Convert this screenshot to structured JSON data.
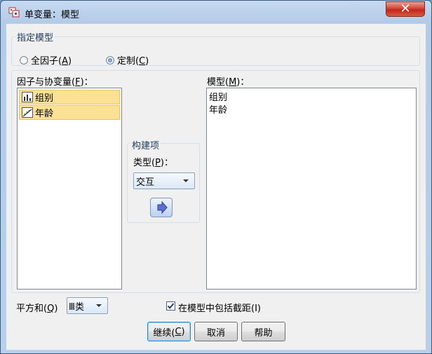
{
  "window": {
    "title": "单变量：模型",
    "close_glyph": "✕"
  },
  "specify_model": {
    "group_label": "指定模型",
    "options": [
      {
        "label": "全因子(",
        "mnemonic": "A",
        "suffix": ")",
        "selected": false
      },
      {
        "label": "定制(",
        "mnemonic": "C",
        "suffix": ")",
        "selected": true
      }
    ]
  },
  "factors": {
    "label_pre": "因子与协变量(",
    "mnemonic": "F",
    "label_post": ")：",
    "items": [
      {
        "label": "组别",
        "icon": "nominal-bar-icon"
      },
      {
        "label": "年龄",
        "icon": "scale-ruler-icon"
      }
    ]
  },
  "build_term": {
    "group_label": "构建项",
    "type_label_pre": "类型(",
    "type_mnemonic": "P",
    "type_label_post": ")：",
    "type_value": "交互",
    "move_icon": "arrow-right-icon"
  },
  "model": {
    "label_pre": "模型(",
    "mnemonic": "M",
    "label_post": ")：",
    "items": [
      "组别",
      "年龄"
    ]
  },
  "sum_of_squares": {
    "label_pre": "平方和(",
    "mnemonic": "Q",
    "label_post": ")",
    "value": "Ⅲ类"
  },
  "include_intercept": {
    "label": "在模型中包括截距(I)",
    "checked": true
  },
  "buttons": {
    "continue_pre": "继续(",
    "continue_mnemonic": "C",
    "continue_post": ")",
    "cancel": "取消",
    "help": "帮助"
  },
  "colors": {
    "selection": "#fbe193",
    "titlebar": "#b9cfea",
    "close": "#c1261a"
  }
}
